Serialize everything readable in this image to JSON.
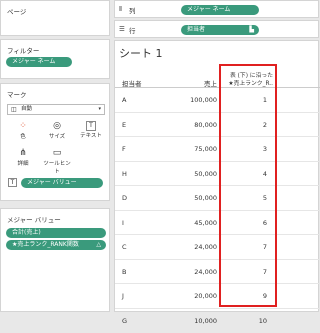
{
  "pages": {
    "title": "ページ"
  },
  "filters": {
    "title": "フィルター",
    "pill": "メジャー ネーム"
  },
  "marks": {
    "title": "マーク",
    "type_icon": "auto-icon",
    "type_label": "自動",
    "buttons": [
      {
        "icon": "color-icon",
        "label": "色"
      },
      {
        "icon": "size-icon",
        "label": "サイズ"
      },
      {
        "icon": "text-icon",
        "label": "テキスト"
      },
      {
        "icon": "detail-icon",
        "label": "詳細"
      },
      {
        "icon": "tooltip-icon",
        "label": "ツールヒント"
      }
    ],
    "text_pill": "メジャー バリュー"
  },
  "measure_values": {
    "title": "メジャー バリュー",
    "pills": [
      "合計(売上)",
      "★売上ランク_RANK関数"
    ]
  },
  "shelves": {
    "columns_label": "列",
    "columns_pill": "メジャー ネーム",
    "rows_label": "行",
    "rows_pill": "担当者"
  },
  "sheet": {
    "title": "シート 1",
    "col_headers": {
      "name": "担当者",
      "sales": "売上",
      "rank_line1": "表 (下) に沿った",
      "rank_line2": "★売上ランク_R.."
    },
    "rows": [
      {
        "name": "A",
        "sales": "100,000",
        "rank": "1"
      },
      {
        "name": "E",
        "sales": "80,000",
        "rank": "2"
      },
      {
        "name": "F",
        "sales": "75,000",
        "rank": "3"
      },
      {
        "name": "H",
        "sales": "50,000",
        "rank": "4"
      },
      {
        "name": "D",
        "sales": "50,000",
        "rank": "5"
      },
      {
        "name": "I",
        "sales": "45,000",
        "rank": "6"
      },
      {
        "name": "C",
        "sales": "24,000",
        "rank": "7"
      },
      {
        "name": "B",
        "sales": "24,000",
        "rank": "7"
      },
      {
        "name": "J",
        "sales": "20,000",
        "rank": "9"
      },
      {
        "name": "G",
        "sales": "10,000",
        "rank": "10"
      }
    ]
  },
  "colors": {
    "pill": "#3a9a7c",
    "highlight": "#e02020"
  }
}
